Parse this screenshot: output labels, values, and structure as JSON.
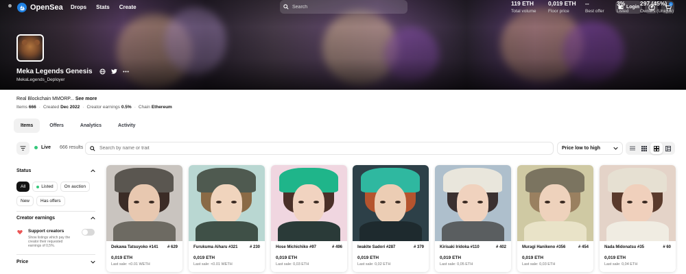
{
  "nav": {
    "logo_text": "OpenSea",
    "links": [
      "Drops",
      "Stats",
      "Create"
    ],
    "search_placeholder": "Search",
    "login_label": "Login",
    "cart_count": "0"
  },
  "collection": {
    "name": "Meka Legends Genesis",
    "creator": "MekaLegends_Deployer",
    "description": "Real Blockchain MMORP...",
    "see_more": "See more",
    "items_label": "Items",
    "items_value": "666",
    "created_label": "Created",
    "created_value": "Dec 2022",
    "earnings_label": "Creator earnings",
    "earnings_value": "0.5%",
    "chain_label": "Chain",
    "chain_value": "Ethereum"
  },
  "stats": [
    {
      "value": "119 ETH",
      "label": "Total volume"
    },
    {
      "value": "0,019 ETH",
      "label": "Floor price"
    },
    {
      "value": "--",
      "label": "Best offer"
    },
    {
      "value": "3%",
      "label": "Listed"
    },
    {
      "value": "297 (45%)",
      "label": "Owners (Unique)"
    }
  ],
  "tabs": [
    "Items",
    "Offers",
    "Analytics",
    "Activity"
  ],
  "filter_bar": {
    "live_label": "Live",
    "results": "666 results",
    "search_placeholder": "Search by name or trait",
    "sort_label": "Price low to high"
  },
  "sidebar": {
    "status_title": "Status",
    "status_chips": [
      "All",
      "Listed",
      "On auction",
      "New",
      "Has offers"
    ],
    "earnings_title": "Creator earnings",
    "support_title": "Support creators",
    "support_desc": "Show listings which pay the creator their requested earnings of 0,5%.",
    "price_title": "Price"
  },
  "cards": [
    {
      "name": "Dekawa Tatsuyoko #141",
      "rank": "# 629",
      "price": "0,019 ETH",
      "last_sale": "Last sale: <0.01 WETH",
      "bg": "#c9c4bf",
      "hair": "#3b2c26",
      "helmet": "#5a5650",
      "skin": "#e8c8b0",
      "body": "#6d6a62"
    },
    {
      "name": "Furukuma Aiharu #321",
      "rank": "# 230",
      "price": "0,019 ETH",
      "last_sale": "Last sale: <0.01 WETH",
      "bg": "#b9d7d2",
      "hair": "#8a6a46",
      "helmet": "#4f5a50",
      "skin": "#f0d4bd",
      "body": "#3f5047"
    },
    {
      "name": "Hose Michichiko #97",
      "rank": "# 496",
      "price": "0,019 ETH",
      "last_sale": "Last sale: 0,03 ETH",
      "bg": "#f0d6e0",
      "hair": "#4a3028",
      "helmet": "#1fb58a",
      "skin": "#f1d3c0",
      "body": "#2a3a38"
    },
    {
      "name": "Iwakite Sadori #287",
      "rank": "# 379",
      "price": "0,019 ETH",
      "last_sale": "Last sale: 0,02 ETH",
      "bg": "#2d4048",
      "hair": "#b5542e",
      "helmet": "#2fb8a0",
      "skin": "#eccdb4",
      "body": "#1e2a2e"
    },
    {
      "name": "Kirisaki Iridoka #110",
      "rank": "# 402",
      "price": "0,019 ETH",
      "last_sale": "Last sale: 0,05 ETH",
      "bg": "#aebfcc",
      "hair": "#3a3030",
      "helmet": "#e9e6dc",
      "skin": "#f0d2be",
      "body": "#5a5e60"
    },
    {
      "name": "Muragi Hanikeno #356",
      "rank": "# 454",
      "price": "0,019 ETH",
      "last_sale": "Last sale: 0,03 ETH",
      "bg": "#cfc9a3",
      "hair": "#9a8060",
      "helmet": "#7b7460",
      "skin": "#eed2bc",
      "body": "#e9e3c8"
    },
    {
      "name": "Nada Midonatsu #35",
      "rank": "# 60",
      "price": "0,019 ETH",
      "last_sale": "Last sale: 0,04 ETH",
      "bg": "#e4d3c8",
      "hair": "#5a3a2c",
      "helmet": "#e6e0d2",
      "skin": "#f0d0bc",
      "body": "#f0ece2"
    }
  ]
}
